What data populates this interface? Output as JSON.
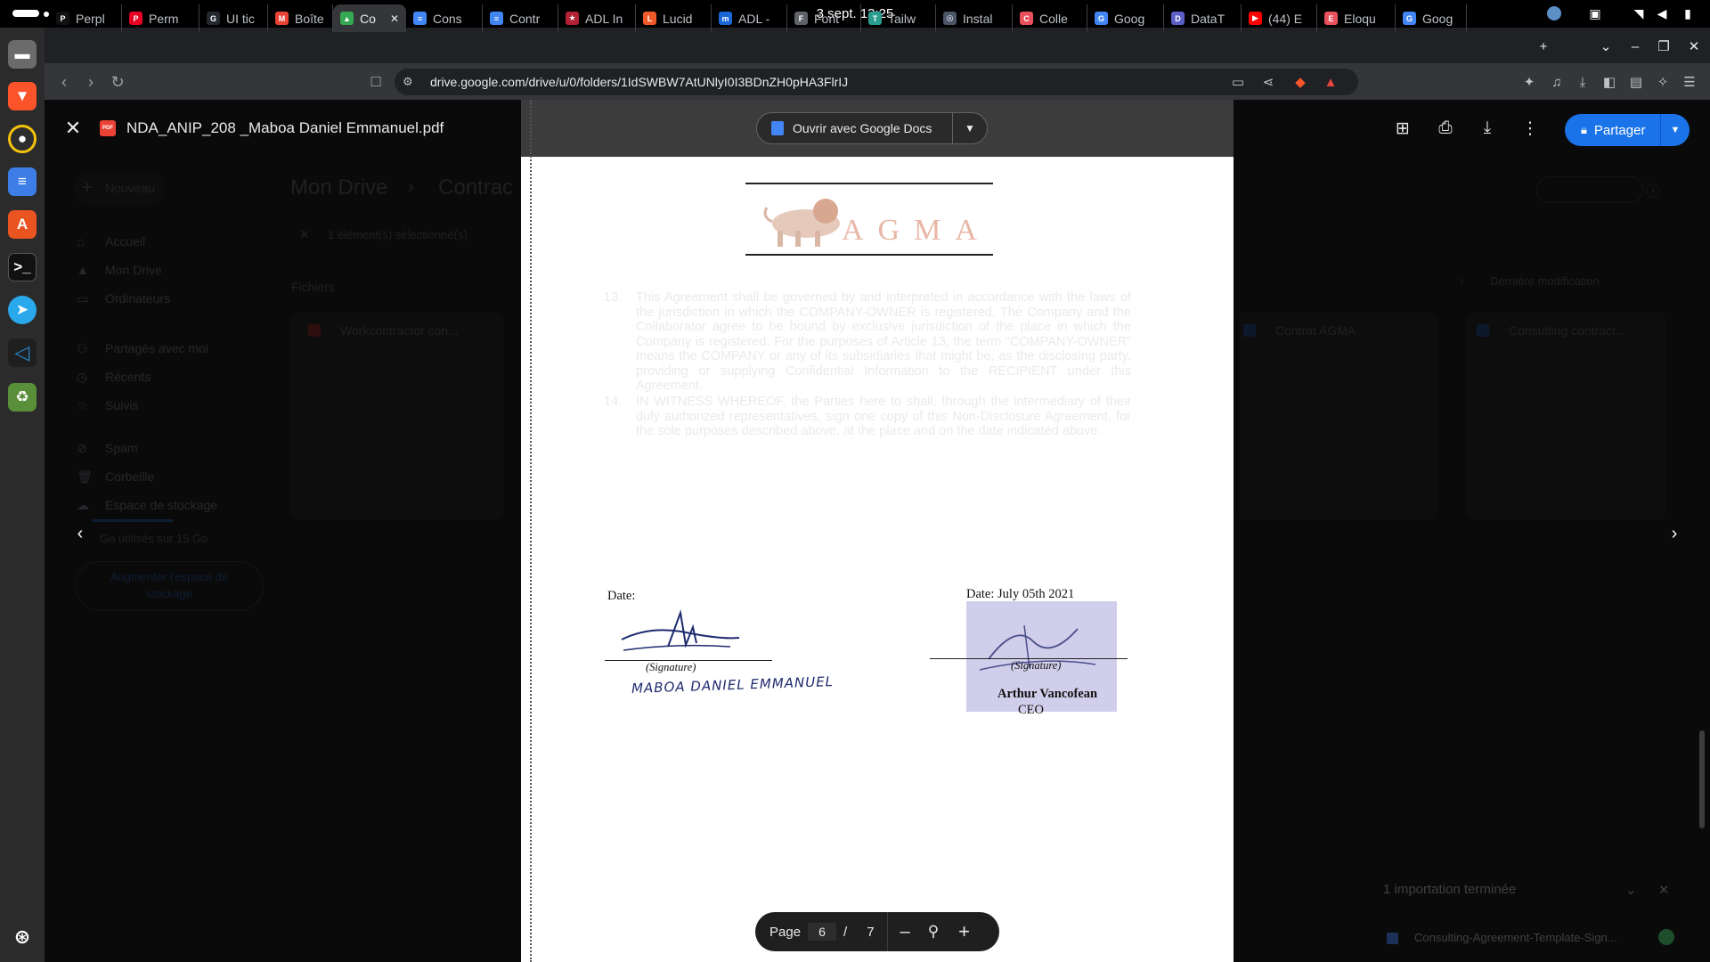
{
  "system": {
    "clock": "3 sept.  13:25"
  },
  "browser": {
    "tabs": [
      {
        "label": "Perpl",
        "favicon_color": "#111111",
        "glyph": "P"
      },
      {
        "label": "Perm",
        "favicon_color": "#e60023",
        "glyph": "P"
      },
      {
        "label": "UI tic",
        "favicon_color": "#24292f",
        "glyph": "G"
      },
      {
        "label": "Boîte",
        "favicon_color": "#ea4335",
        "glyph": "M"
      },
      {
        "label": "Co",
        "favicon_color": "#34a853",
        "glyph": "▲"
      },
      {
        "label": "Cons",
        "favicon_color": "#4285f4",
        "glyph": "≡"
      },
      {
        "label": "Contr",
        "favicon_color": "#4285f4",
        "glyph": "≡"
      },
      {
        "label": "ADL In",
        "favicon_color": "#b22234",
        "glyph": "★"
      },
      {
        "label": "Lucid",
        "favicon_color": "#f05a28",
        "glyph": "L"
      },
      {
        "label": "ADL -",
        "favicon_color": "#1967d2",
        "glyph": "m"
      },
      {
        "label": "Font",
        "favicon_color": "#5f6368",
        "glyph": "F"
      },
      {
        "label": "Tailw",
        "favicon_color": "#2a9d8f",
        "glyph": "T"
      },
      {
        "label": "Instal",
        "favicon_color": "#4a5568",
        "glyph": "◎"
      },
      {
        "label": "Colle",
        "favicon_color": "#e8505b",
        "glyph": "C"
      },
      {
        "label": "Goog",
        "favicon_color": "#4285f4",
        "glyph": "G"
      },
      {
        "label": "DataT",
        "favicon_color": "#5b5fc7",
        "glyph": "D"
      },
      {
        "label": "(44) E",
        "favicon_color": "#ff0000",
        "glyph": "▶"
      },
      {
        "label": "Eloqu",
        "favicon_color": "#e8505b",
        "glyph": "E"
      },
      {
        "label": "Goog",
        "favicon_color": "#4285f4",
        "glyph": "G"
      }
    ],
    "url": "drive.google.com/drive/u/0/folders/1IdSWBW7AtUNlyI0I3BDnZH0pHA3FlrIJ"
  },
  "drive_background": {
    "new_button": "Nouveau",
    "breadcrumb_root": "Mon Drive",
    "breadcrumb_current": "Contrac",
    "selection_text": "1 élément(s) sélectionné(s)",
    "files_heading": "Fichiers",
    "sort_label": "Dernière modification",
    "sidebar": [
      "Accueil",
      "Mon Drive",
      "Ordinateurs",
      "Partagés avec moi",
      "Récents",
      "Suivis",
      "Spam",
      "Corbeille",
      "Espace de stockage"
    ],
    "storage_text": "Go utilisés sur 15 Go",
    "storage_button": "Augmenter l'espace de stockage",
    "cards": [
      "Workcontractor con...",
      "Contrat AGMA",
      "Consulting contract..."
    ],
    "toast_title": "1 importation terminée",
    "toast_file": "Consulting-Agreement-Template-Sign..."
  },
  "viewer": {
    "file_name": "NDA_ANIP_208 _Maboa Daniel Emmanuel.pdf",
    "open_with": "Ouvrir avec Google Docs",
    "share": "Partager",
    "page_label": "Page",
    "current_page": "6",
    "page_sep": "/",
    "total_pages": "7"
  },
  "document": {
    "logo": "AGMA",
    "clause13_num": "13.",
    "clause13": "This Agreement shall be governed by and interpreted in accordance with the laws of the jurisdiction in which the COMPANY-OWNER is registered. The Company and the Collaborator agree to be bound by exclusive jurisdiction of the place in which the Company is registered. For the purposes of Article 13, the term “COMPANY-OWNER” means the COMPANY or any of its subsidiaries that might be, as the disclosing party, providing or supplying Confidential Information to the RECIPIENT under this Agreement.",
    "clause14_num": "14.",
    "clause14": "IN WITNESS WHEREOF, the Parties here to shall, through the intermediary of their duly authorized representatives, sign one copy of this Non-Disclosure Agreement, for the sole purposes described above, at the place and on the date indicated above.",
    "left_date": "Date:",
    "left_sig_caption": "(Signature)",
    "left_handwritten_name": "MABOA DANIEL EMMANUEL",
    "right_date": "Date: July   05th 2021",
    "right_sig_caption": "(Signature)",
    "right_name": "Arthur Vancofean",
    "right_title": "CEO"
  }
}
